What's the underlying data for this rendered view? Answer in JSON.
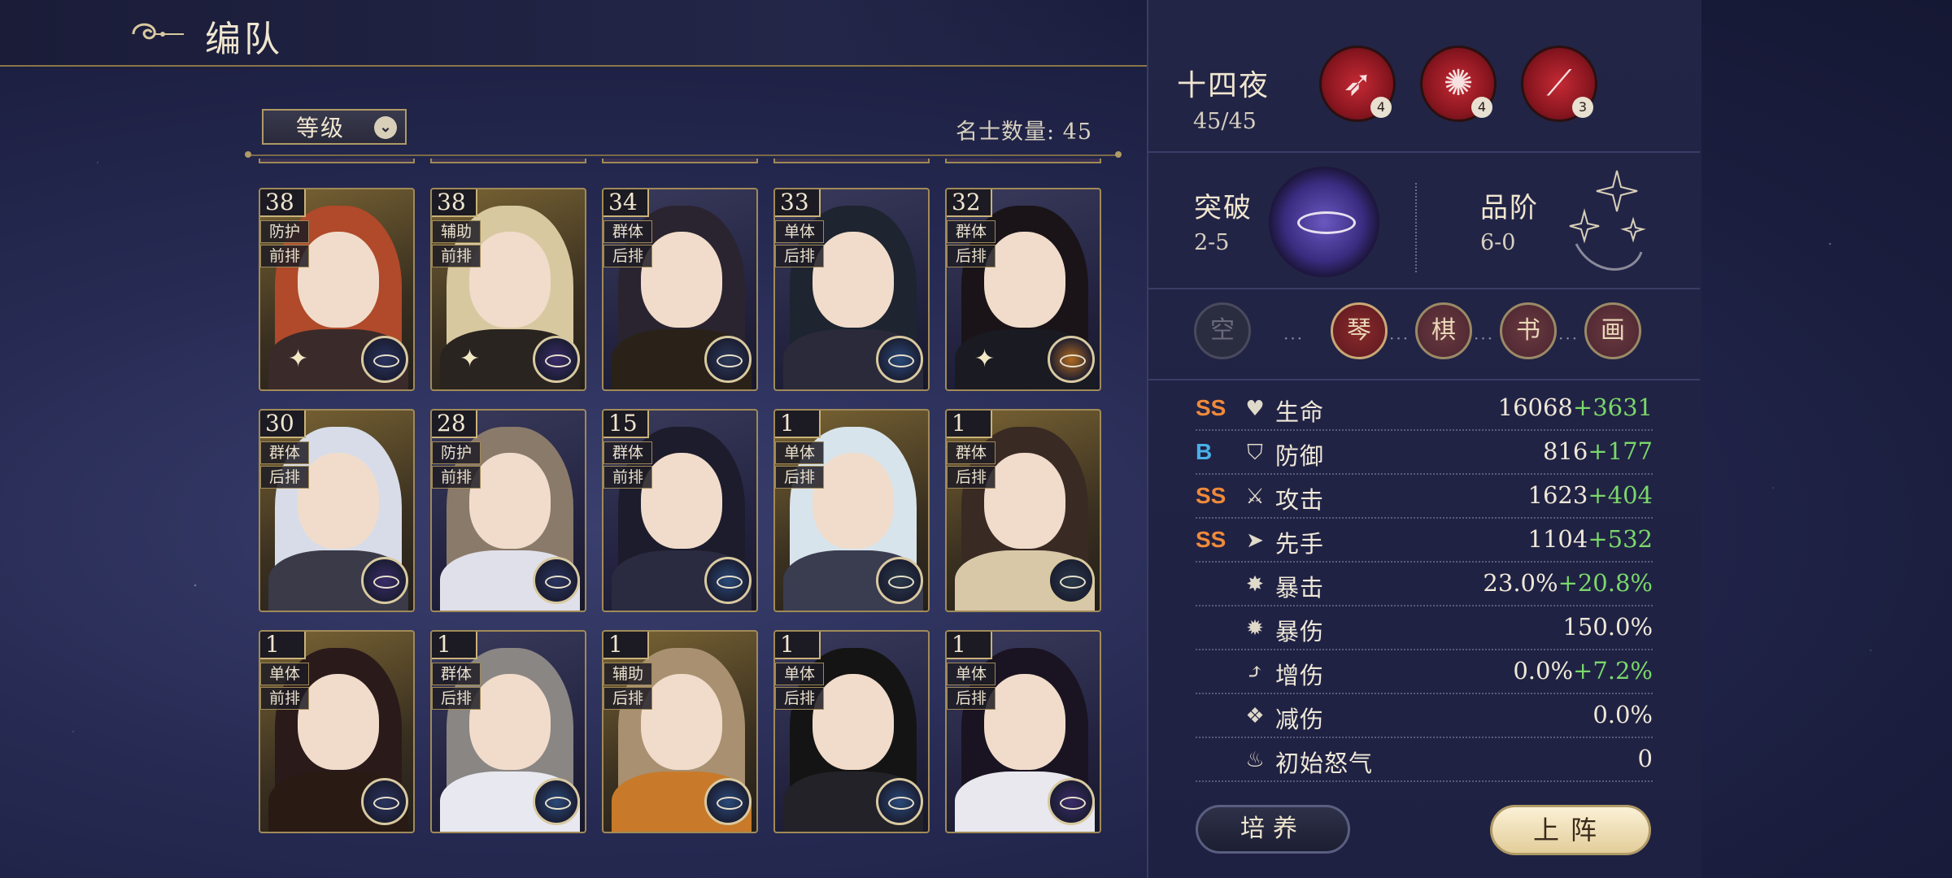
{
  "header": {
    "title": "编队"
  },
  "filter": {
    "sort_label": "等级",
    "count_label": "名士数量: 45"
  },
  "cards": [
    {
      "level": "38",
      "role": "防护",
      "position": "前排",
      "theme": "gold"
    },
    {
      "level": "38",
      "role": "辅助",
      "position": "前排",
      "theme": "gold"
    },
    {
      "level": "34",
      "role": "群体",
      "position": "后排",
      "theme": "dark"
    },
    {
      "level": "33",
      "role": "单体",
      "position": "后排",
      "theme": "dark"
    },
    {
      "level": "32",
      "role": "群体",
      "position": "后排",
      "theme": "dark"
    },
    {
      "level": "30",
      "role": "群体",
      "position": "后排",
      "theme": "gold"
    },
    {
      "level": "28",
      "role": "防护",
      "position": "前排",
      "theme": "dark"
    },
    {
      "level": "15",
      "role": "群体",
      "position": "前排",
      "theme": "dark"
    },
    {
      "level": "1",
      "role": "单体",
      "position": "后排",
      "theme": "gold"
    },
    {
      "level": "1",
      "role": "群体",
      "position": "后排",
      "theme": "gold"
    },
    {
      "level": "1",
      "role": "单体",
      "position": "前排",
      "theme": "gold"
    },
    {
      "level": "1",
      "role": "群体",
      "position": "后排",
      "theme": "dark"
    },
    {
      "level": "1",
      "role": "辅助",
      "position": "后排",
      "theme": "gold"
    },
    {
      "level": "1",
      "role": "单体",
      "position": "后排",
      "theme": "dark"
    },
    {
      "level": "1",
      "role": "单体",
      "position": "后排",
      "theme": "dark"
    }
  ],
  "character": {
    "name": "十四夜",
    "count": "45/45",
    "skills": [
      {
        "level": "4",
        "icon": "spear-icon"
      },
      {
        "level": "4",
        "icon": "swirl-blade-icon"
      },
      {
        "level": "3",
        "icon": "slash-icon"
      }
    ],
    "breakthrough_label": "突破",
    "breakthrough_value": "2-5",
    "rank_label": "品阶",
    "rank_value": "6-0",
    "slots": [
      "空",
      "琴",
      "棋",
      "书",
      "画"
    ]
  },
  "stats": [
    {
      "grade": "SS",
      "icon": "heart-icon",
      "name": "生命",
      "base": "16068",
      "bonus": "+3631"
    },
    {
      "grade": "B",
      "icon": "shield-icon",
      "name": "防御",
      "base": "816",
      "bonus": "+177"
    },
    {
      "grade": "SS",
      "icon": "sword-icon",
      "name": "攻击",
      "base": "1623",
      "bonus": "+404"
    },
    {
      "grade": "SS",
      "icon": "speed-icon",
      "name": "先手",
      "base": "1104",
      "bonus": "+532"
    },
    {
      "grade": "",
      "icon": "crit-icon",
      "name": "暴击",
      "base": "23.0%",
      "bonus": "+20.8%"
    },
    {
      "grade": "",
      "icon": "crit-damage-icon",
      "name": "暴伤",
      "base": "150.0%",
      "bonus": ""
    },
    {
      "grade": "",
      "icon": "damage-boost-icon",
      "name": "增伤",
      "base": "0.0%",
      "bonus": "+7.2%"
    },
    {
      "grade": "",
      "icon": "damage-reduce-icon",
      "name": "减伤",
      "base": "0.0%",
      "bonus": ""
    },
    {
      "grade": "",
      "icon": "rage-icon",
      "name": "初始怒气",
      "base": "0",
      "bonus": ""
    }
  ],
  "buttons": {
    "train": "培养",
    "deploy": "上阵"
  }
}
